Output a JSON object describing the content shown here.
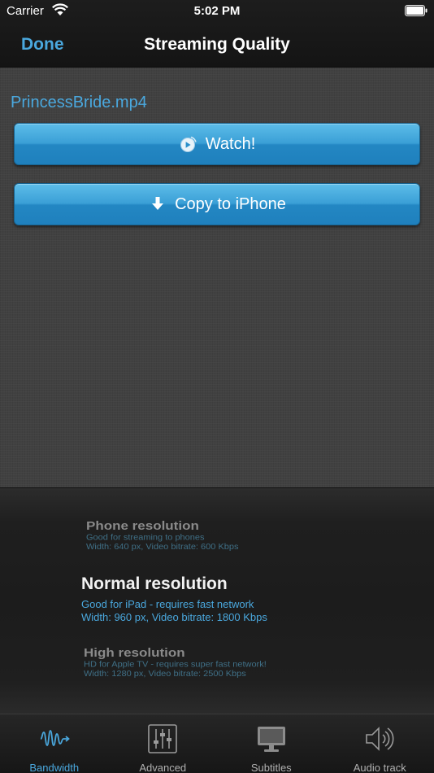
{
  "status_bar": {
    "carrier": "Carrier",
    "time": "5:02 PM"
  },
  "nav": {
    "back_label": "Done",
    "title": "Streaming Quality"
  },
  "file": {
    "name": "PrincessBride.mp4"
  },
  "actions": {
    "watch_label": "Watch!",
    "copy_label": "Copy to iPhone"
  },
  "quality_picker": {
    "options": [
      {
        "title": "Phone resolution",
        "description": "Good for streaming to phones",
        "specs": "Width: 640 px, Video bitrate: 600 Kbps"
      },
      {
        "title": "Normal resolution",
        "description": "Good for iPad - requires fast network",
        "specs": "Width: 960 px, Video bitrate: 1800 Kbps",
        "selected": true
      },
      {
        "title": "High resolution",
        "description": "HD for Apple TV - requires super fast network!",
        "specs": "Width: 1280 px, Video bitrate: 2500 Kbps"
      }
    ]
  },
  "tabs": [
    {
      "label": "Bandwidth",
      "icon": "waveform-icon",
      "active": true
    },
    {
      "label": "Advanced",
      "icon": "sliders-icon",
      "active": false
    },
    {
      "label": "Subtitles",
      "icon": "monitor-icon",
      "active": false
    },
    {
      "label": "Audio track",
      "icon": "speaker-icon",
      "active": false
    }
  ],
  "colors": {
    "accent": "#4aa8de",
    "button_blue": "#2a8fca",
    "background": "#414141"
  }
}
